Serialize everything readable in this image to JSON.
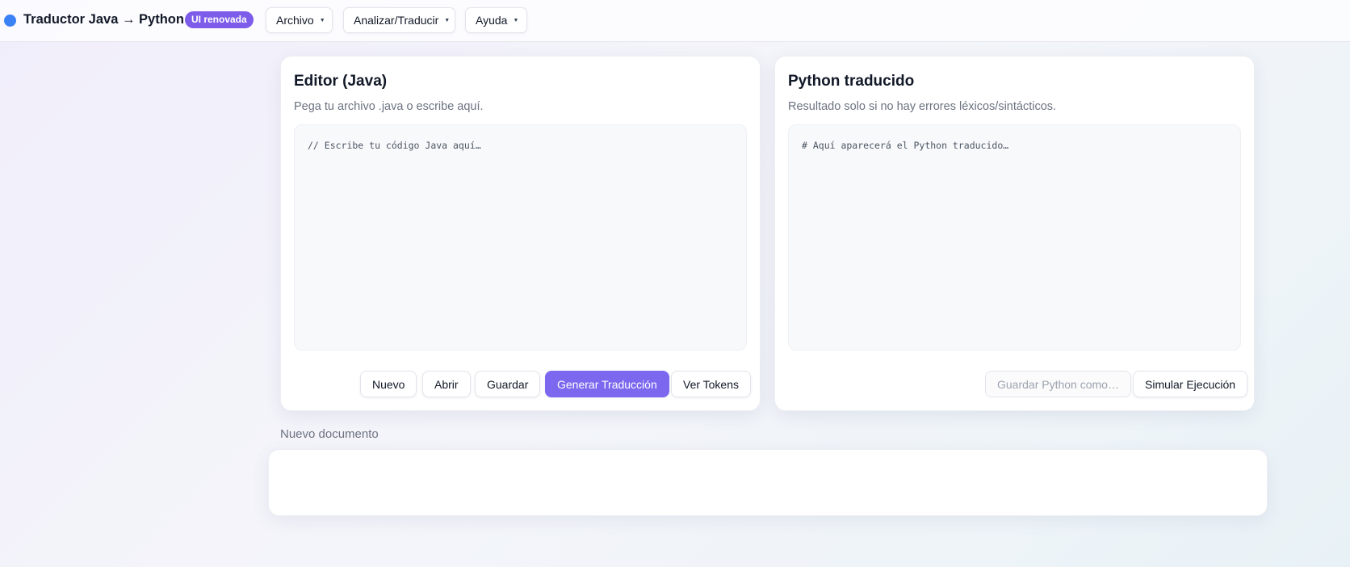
{
  "header": {
    "title": "Traductor Java → Python",
    "badge": "UI renovada",
    "menus": [
      {
        "label": "Archivo",
        "caret": "▼"
      },
      {
        "label": "Analizar/Traducir",
        "caret": "▼"
      },
      {
        "label": "Ayuda",
        "caret": "▼"
      }
    ]
  },
  "editor": {
    "title": "Editor (Java)",
    "subtitle": "Pega tu archivo .java o escribe aquí.",
    "placeholder": "// Escribe tu código Java aquí…",
    "buttons": {
      "new": "Nuevo",
      "open": "Abrir",
      "save": "Guardar",
      "translate": "Generar Traducción",
      "tokens": "Ver Tokens"
    }
  },
  "python": {
    "title": "Python traducido",
    "subtitle": "Resultado solo si no hay errores léxicos/sintácticos.",
    "placeholder": "# Aquí aparecerá el Python traducido…",
    "buttons": {
      "save_as": "Guardar Python como…",
      "simulate": "Simular Ejecución"
    }
  },
  "status": {
    "document": "Nuevo documento"
  },
  "colors": {
    "accent": "#7b68ee",
    "badge": "#7c5ce8",
    "dot": "#3b82f6"
  }
}
